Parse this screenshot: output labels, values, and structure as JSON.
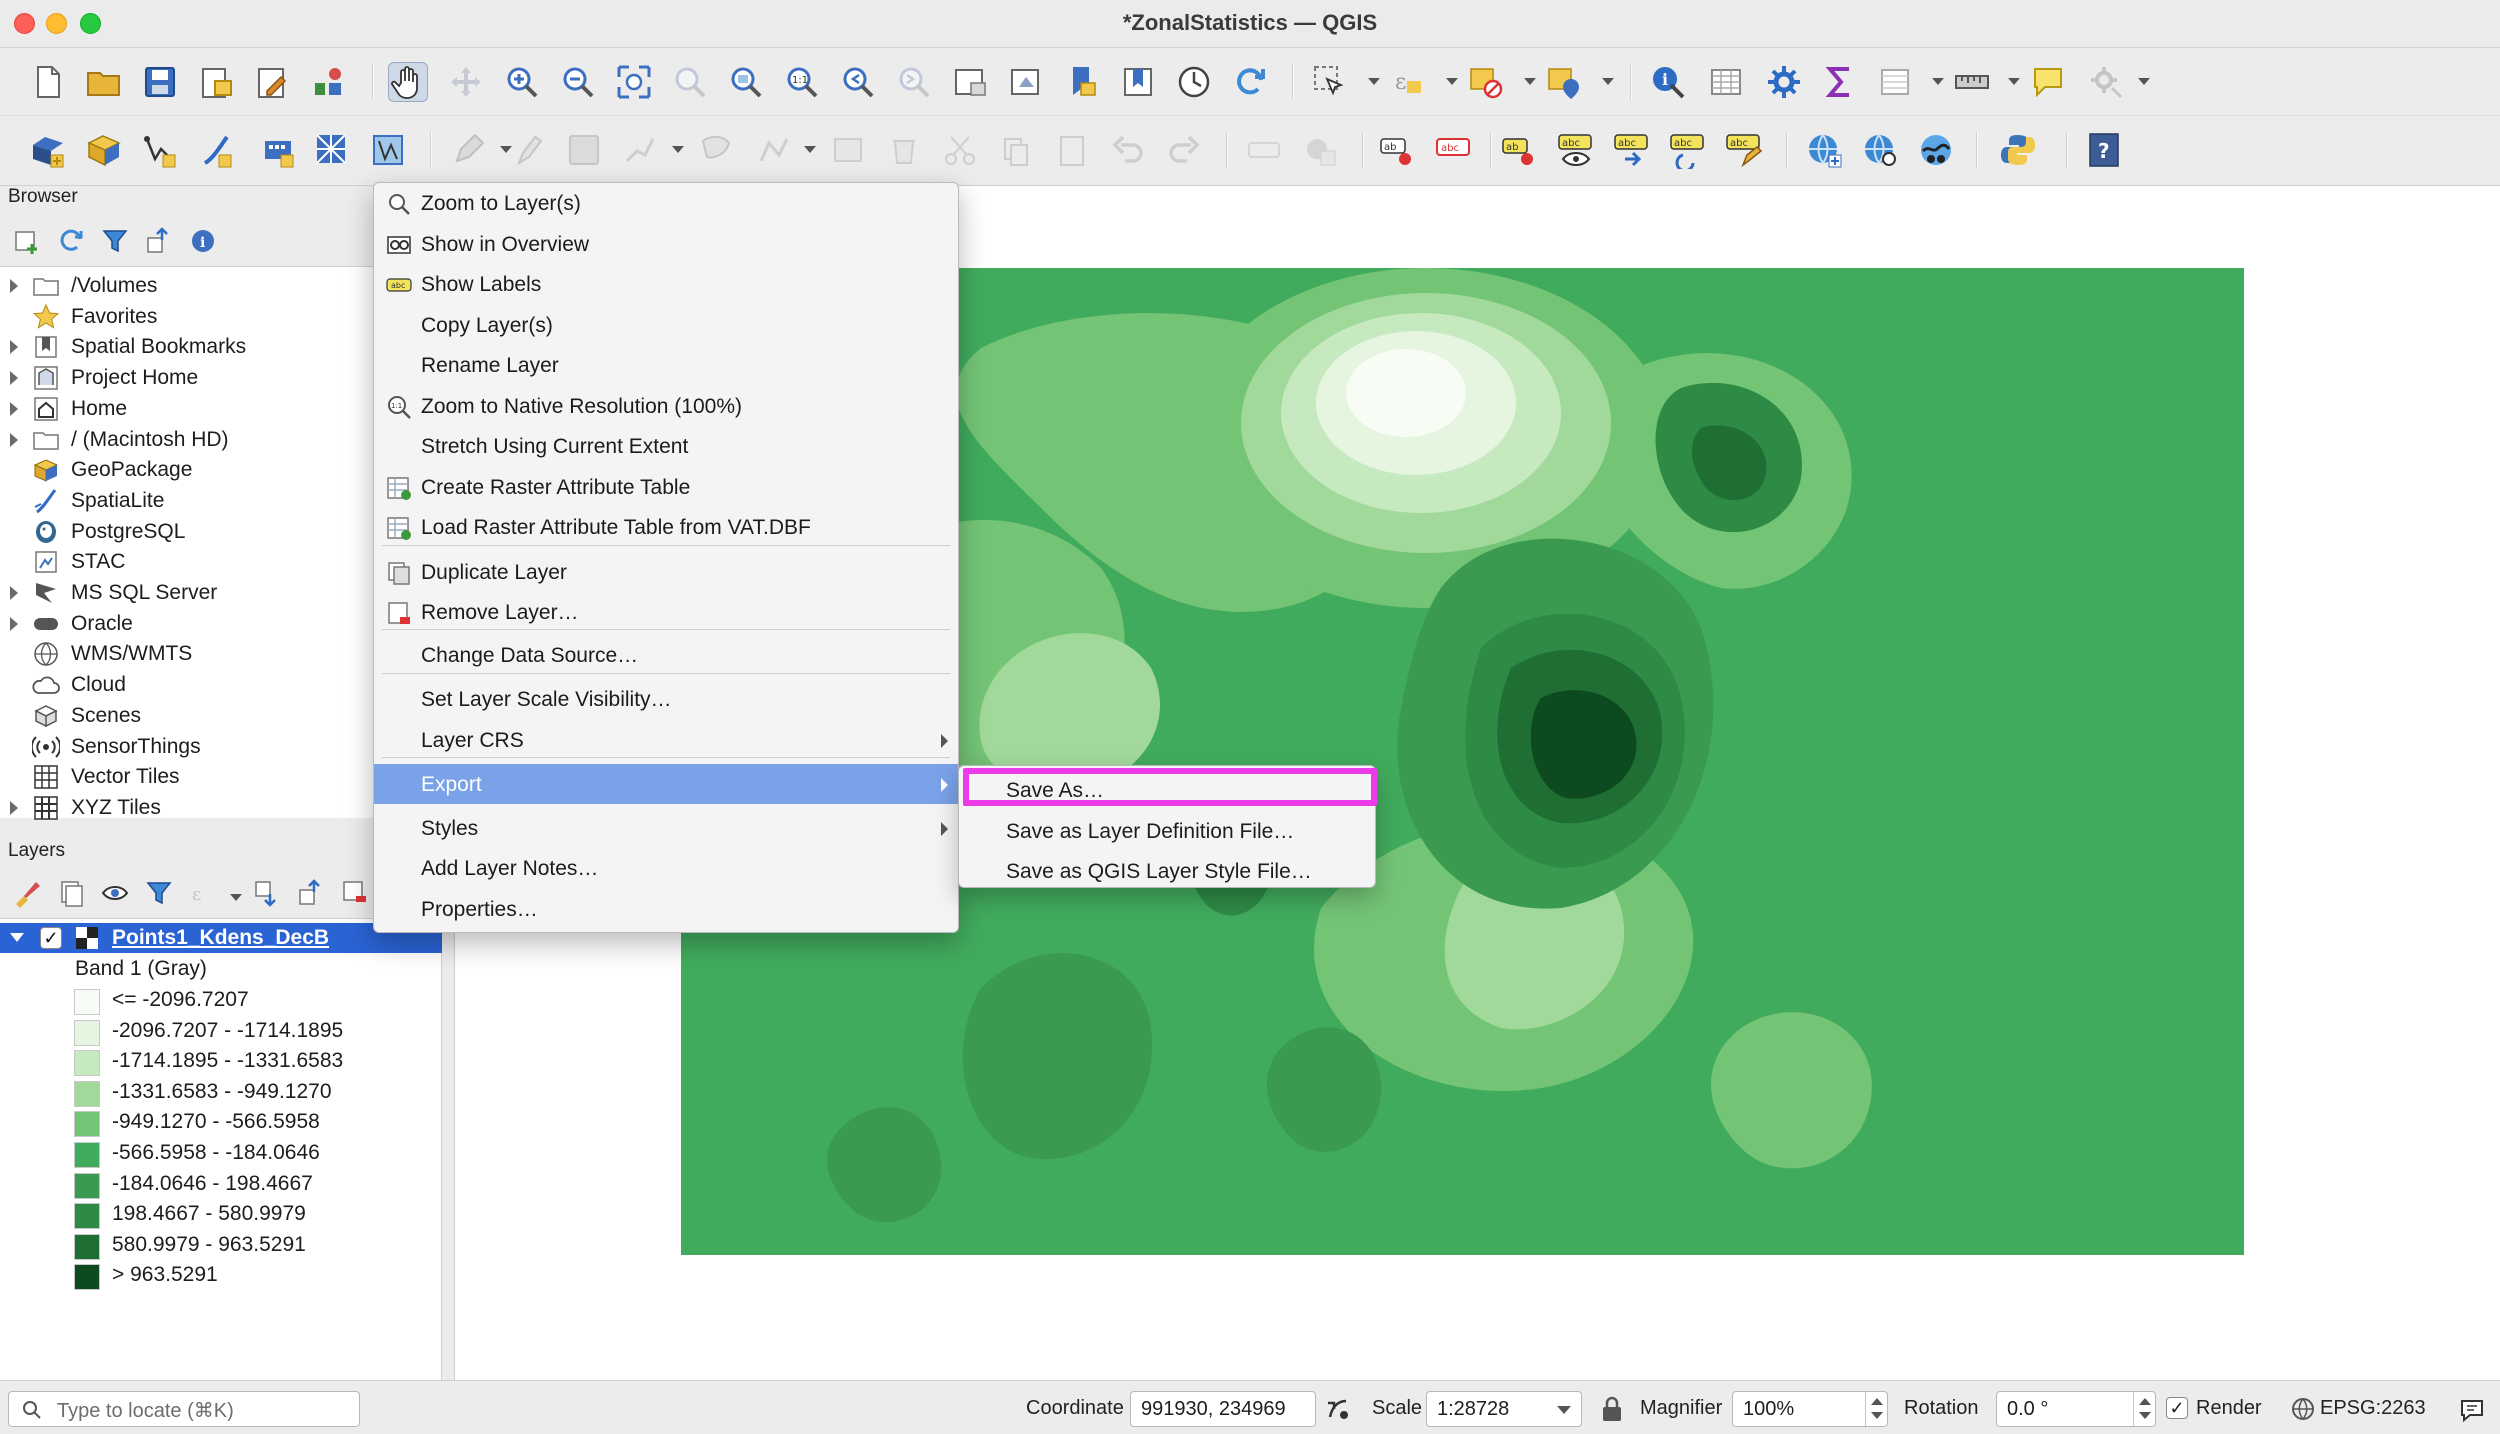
{
  "window": {
    "title": "*ZonalStatistics — QGIS"
  },
  "browser": {
    "title": "Browser",
    "items": [
      {
        "label": "/Volumes",
        "icon": "folder-icon",
        "expandable": true
      },
      {
        "label": "Favorites",
        "icon": "star-icon",
        "expandable": false
      },
      {
        "label": "Spatial Bookmarks",
        "icon": "bookmark-icon",
        "expandable": true
      },
      {
        "label": "Project Home",
        "icon": "project-home-icon",
        "expandable": true
      },
      {
        "label": "Home",
        "icon": "home-icon",
        "expandable": true
      },
      {
        "label": "/ (Macintosh HD)",
        "icon": "folder-icon",
        "expandable": true
      },
      {
        "label": "GeoPackage",
        "icon": "geopackage-icon",
        "expandable": false
      },
      {
        "label": "SpatiaLite",
        "icon": "spatialite-icon",
        "expandable": false
      },
      {
        "label": "PostgreSQL",
        "icon": "postgresql-icon",
        "expandable": false
      },
      {
        "label": "STAC",
        "icon": "stac-icon",
        "expandable": false
      },
      {
        "label": "MS SQL Server",
        "icon": "mssql-icon",
        "expandable": true
      },
      {
        "label": "Oracle",
        "icon": "oracle-icon",
        "expandable": true
      },
      {
        "label": "WMS/WMTS",
        "icon": "wms-icon",
        "expandable": false
      },
      {
        "label": "Cloud",
        "icon": "cloud-icon",
        "expandable": false
      },
      {
        "label": "Scenes",
        "icon": "scenes-icon",
        "expandable": false
      },
      {
        "label": "SensorThings",
        "icon": "sensorthings-icon",
        "expandable": false
      },
      {
        "label": "Vector Tiles",
        "icon": "vector-tiles-icon",
        "expandable": false
      },
      {
        "label": "XYZ Tiles",
        "icon": "xyz-tiles-icon",
        "expandable": true
      }
    ]
  },
  "layers": {
    "title": "Layers",
    "layer_name": "Points1_Kdens_DecB",
    "checked": true,
    "band_label": "Band 1 (Gray)",
    "legend": [
      {
        "label": "<= -2096.7207",
        "color": "#f7fcf5"
      },
      {
        "label": "-2096.7207 - -1714.1895",
        "color": "#e5f5e0"
      },
      {
        "label": "-1714.1895 - -1331.6583",
        "color": "#c7e9c0"
      },
      {
        "label": "-1331.6583 - -949.1270",
        "color": "#a1d99b"
      },
      {
        "label": "-949.1270 - -566.5958",
        "color": "#74c476"
      },
      {
        "label": "-566.5958 - -184.0646",
        "color": "#41ab5d"
      },
      {
        "label": "-184.0646 - 198.4667",
        "color": "#3a9a50"
      },
      {
        "label": "198.4667 - 580.9979",
        "color": "#2e8b46"
      },
      {
        "label": "580.9979 - 963.5291",
        "color": "#1f6e33"
      },
      {
        "label": "> 963.5291",
        "color": "#0d4a1f"
      }
    ]
  },
  "context_menu": {
    "items": [
      {
        "label": "Zoom to Layer(s)",
        "icon": "zoom-layer-icon"
      },
      {
        "label": "Show in Overview",
        "icon": "overview-icon"
      },
      {
        "label": "Show Labels",
        "icon": "labels-icon"
      },
      {
        "label": "Copy Layer(s)",
        "icon": ""
      },
      {
        "label": "Rename Layer",
        "icon": ""
      },
      {
        "label": "Zoom to Native Resolution (100%)",
        "icon": "zoom-native-icon"
      },
      {
        "label": "Stretch Using Current Extent",
        "icon": ""
      },
      {
        "label": "Create Raster Attribute Table",
        "icon": "table-add-icon"
      },
      {
        "label": "Load Raster Attribute Table from VAT.DBF",
        "icon": "table-load-icon"
      },
      {
        "label": "Duplicate Layer",
        "icon": "duplicate-icon"
      },
      {
        "label": "Remove Layer…",
        "icon": "remove-layer-icon"
      },
      {
        "label": "Change Data Source…",
        "icon": ""
      },
      {
        "label": "Set Layer Scale Visibility…",
        "icon": ""
      },
      {
        "label": "Layer CRS",
        "icon": "",
        "submenu": true
      },
      {
        "label": "Export",
        "icon": "",
        "submenu": true,
        "highlighted": true
      },
      {
        "label": "Styles",
        "icon": "",
        "submenu": true
      },
      {
        "label": "Add Layer Notes…",
        "icon": ""
      },
      {
        "label": "Properties…",
        "icon": ""
      }
    ]
  },
  "export_submenu": {
    "items": [
      {
        "label": "Save As…",
        "highlighted": true
      },
      {
        "label": "Save as Layer Definition File…"
      },
      {
        "label": "Save as QGIS Layer Style File…"
      }
    ]
  },
  "statusbar": {
    "locator_placeholder": "Type to locate (⌘K)",
    "coordinate_label": "Coordinate",
    "coordinate_value": "991930, 234969",
    "scale_label": "Scale",
    "scale_value": "1:28728",
    "magnifier_label": "Magnifier",
    "magnifier_value": "100%",
    "rotation_label": "Rotation",
    "rotation_value": "0.0 °",
    "render_label": "Render",
    "render_checked": true,
    "crs_label": "EPSG:2263"
  },
  "colors": {
    "selection_blue": "#2a63d4",
    "menu_highlight": "#7aa2e8",
    "callout_magenta": "#ec3be8",
    "map_base_green": "#41ab5d"
  }
}
